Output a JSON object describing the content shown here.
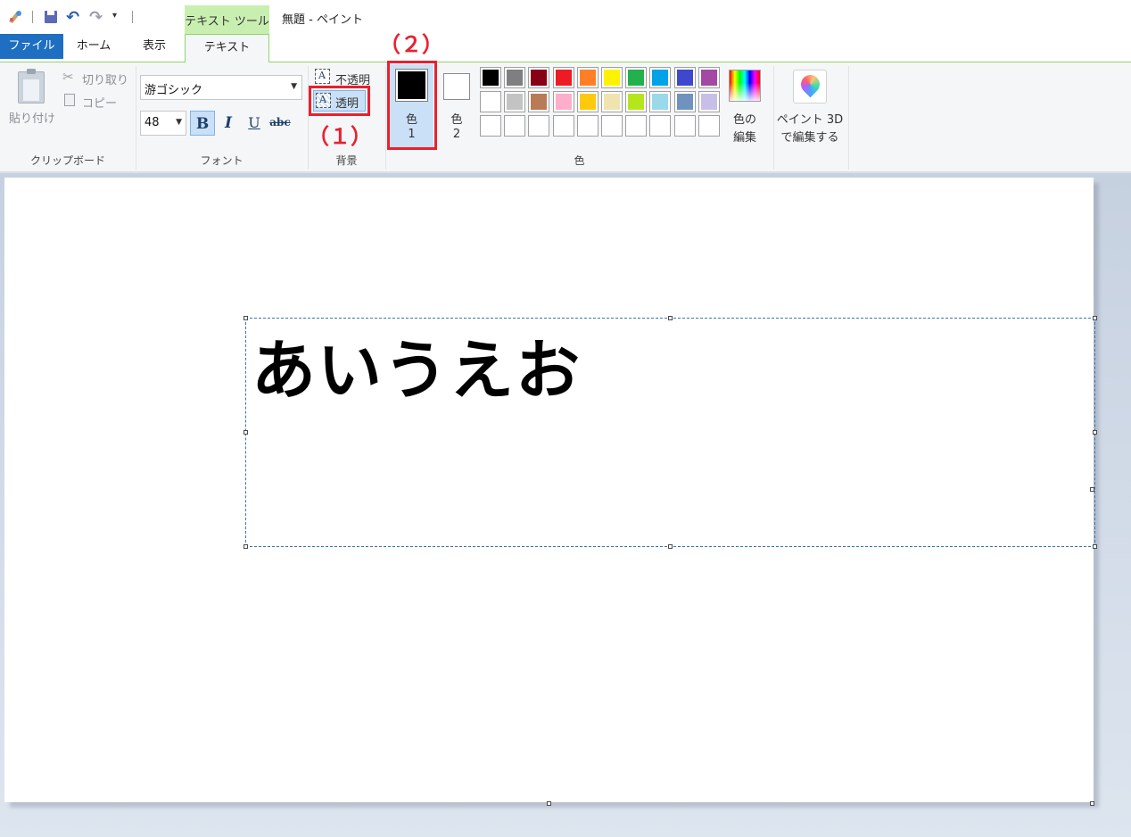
{
  "window": {
    "title": "無題 - ペイント",
    "context_tab": "テキスト ツール"
  },
  "tabs": {
    "file": "ファイル",
    "home": "ホーム",
    "view": "表示",
    "text": "テキスト"
  },
  "clipboard": {
    "paste": "貼り付け",
    "cut": "切り取り",
    "copy": "コピー",
    "label": "クリップボード"
  },
  "font": {
    "family": "游ゴシック",
    "size": "48",
    "bold": "B",
    "italic": "I",
    "underline": "U",
    "strike": "abc",
    "label": "フォント"
  },
  "background": {
    "opaque": "不透明",
    "transparent": "透明",
    "label": "背景",
    "icon_letter": "A"
  },
  "colors": {
    "color1_line1": "色",
    "color1_line2": "1",
    "color2_line1": "色",
    "color2_line2": "2",
    "edit_line1": "色の",
    "edit_line2": "編集",
    "label": "色",
    "color1_value": "#000000",
    "color2_value": "#ffffff",
    "palette_row1": [
      "#000000",
      "#7f7f7f",
      "#880015",
      "#ed1c24",
      "#ff7f27",
      "#fff200",
      "#22b14c",
      "#00a2e8",
      "#3f48cc",
      "#a349a4"
    ],
    "palette_row2": [
      "#ffffff",
      "#c3c3c3",
      "#b97a57",
      "#ffaec9",
      "#ffc90e",
      "#efe4b0",
      "#b5e61d",
      "#99d9ea",
      "#7092be",
      "#c8bfe7"
    ],
    "palette_row3": [
      "#ffffff",
      "#ffffff",
      "#ffffff",
      "#ffffff",
      "#ffffff",
      "#ffffff",
      "#ffffff",
      "#ffffff",
      "#ffffff",
      "#ffffff"
    ]
  },
  "paint3d": {
    "line1": "ペイント 3D",
    "line2": "で編集する"
  },
  "canvas": {
    "text": "あいうえお"
  },
  "annotations": {
    "one": "（１）",
    "two": "（２）"
  }
}
